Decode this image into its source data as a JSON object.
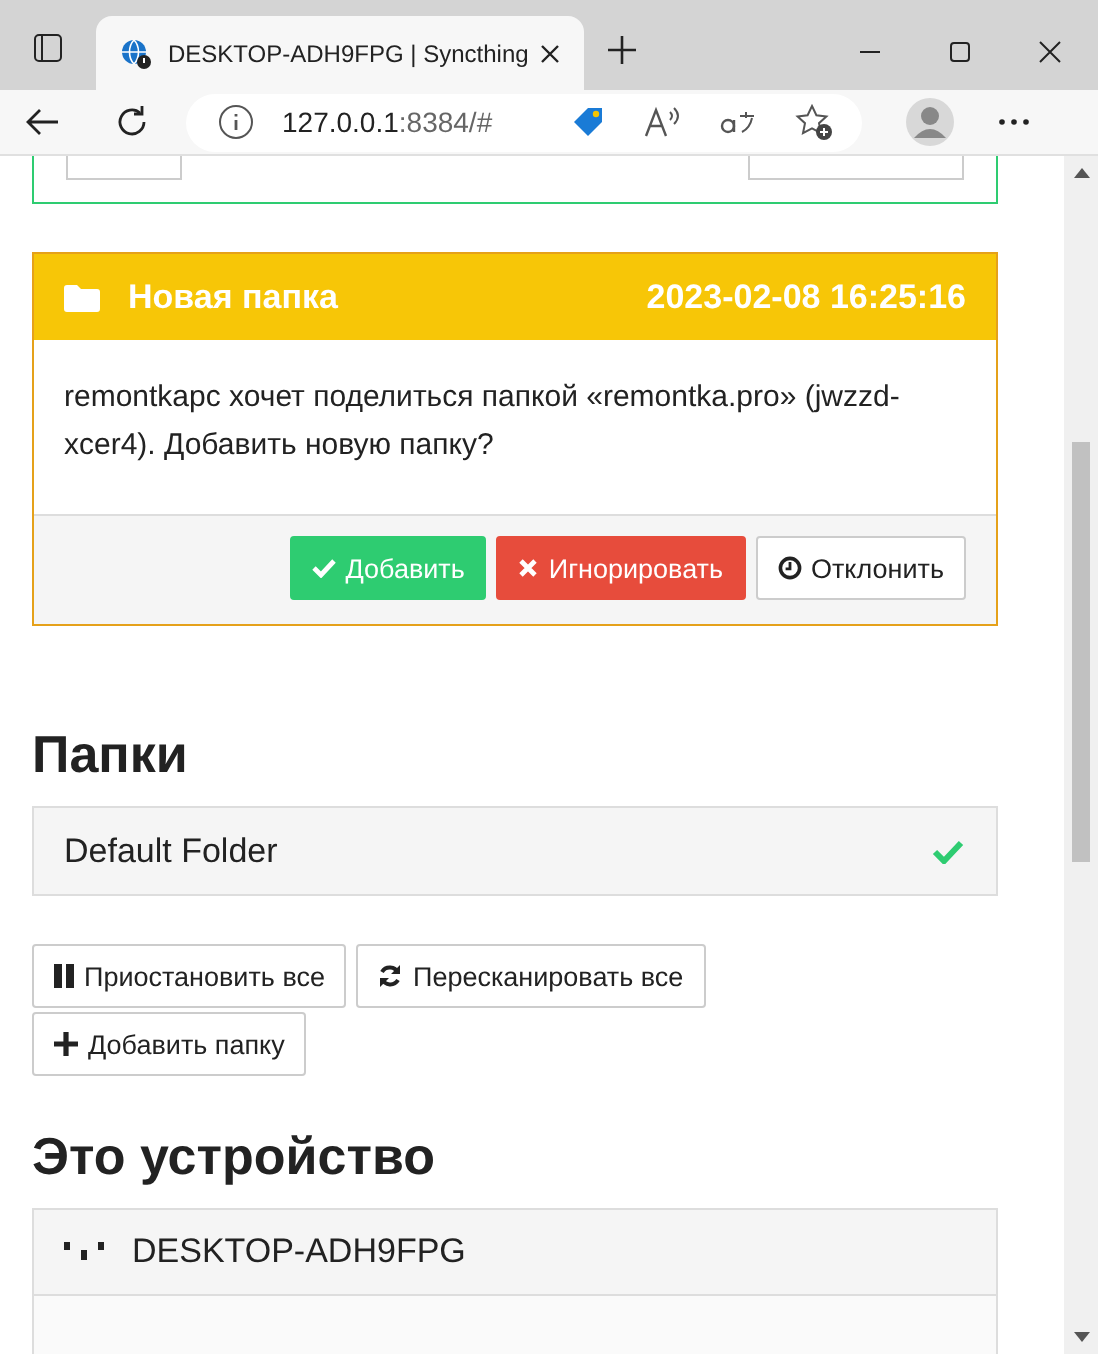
{
  "browser": {
    "tab_title": "DESKTOP-ADH9FPG | Syncthing",
    "url_host": "127.0.0.1",
    "url_rest": ":8384/#"
  },
  "notice": {
    "title": "Новая папка",
    "time": "2023-02-08 16:25:16",
    "message": "remontkapc хочет поделиться папкой «remontka.pro» (jwzzd-xcer4). Добавить новую папку?",
    "buttons": [
      {
        "kind": "add",
        "label": "Добавить"
      },
      {
        "kind": "ignore",
        "label": "Игнорировать"
      },
      {
        "kind": "decline",
        "label": "Отклонить"
      }
    ]
  },
  "folders": {
    "heading": "Папки",
    "items": [
      {
        "name": "Default Folder"
      }
    ],
    "buttons": [
      {
        "kind": "pause",
        "label": "Приостановить все"
      },
      {
        "kind": "rescan",
        "label": "Пересканировать все"
      },
      {
        "kind": "add",
        "label": "Добавить папку"
      }
    ]
  },
  "device": {
    "heading": "Это устройство",
    "name": "DESKTOP-ADH9FPG"
  }
}
